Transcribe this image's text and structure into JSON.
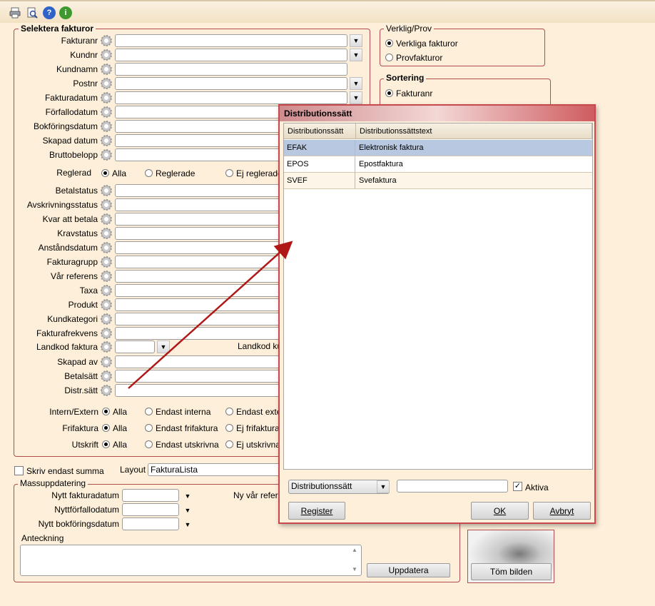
{
  "toolbar": {
    "icons": [
      "print-icon",
      "print-preview-icon",
      "help-icon",
      "info-icon"
    ],
    "help_glyph": "?",
    "info_glyph": "i"
  },
  "select_group": {
    "legend": "Selektera fakturor",
    "fields": [
      {
        "label": "Fakturanr",
        "dropdown": true
      },
      {
        "label": "Kundnr",
        "dropdown": true
      },
      {
        "label": "Kundnamn",
        "dropdown": false
      },
      {
        "label": "Postnr",
        "dropdown": true
      },
      {
        "label": "Fakturadatum",
        "dropdown": true
      },
      {
        "label": "Förfallodatum",
        "dropdown": false
      },
      {
        "label": "Bokföringsdatum",
        "dropdown": false
      },
      {
        "label": "Skapad datum",
        "dropdown": false
      },
      {
        "label": "Bruttobelopp",
        "dropdown": false
      }
    ],
    "reglerad": {
      "label": "Reglerad",
      "options": [
        "Alla",
        "Reglerade",
        "Ej reglerade"
      ],
      "selected": "Alla"
    },
    "fields2": [
      "Betalstatus",
      "Avskrivningsstatus",
      "Kvar att betala",
      "Kravstatus",
      "Anståndsdatum",
      "Fakturagrupp",
      "Vår referens",
      "Taxa",
      "Produkt",
      "Kundkategori",
      "Fakturafrekvens"
    ],
    "landkod_faktura": "Landkod faktura",
    "landkod_kund": "Landkod ku",
    "fields3": [
      "Skapad av",
      "Betalsätt",
      "Distr.sätt"
    ],
    "intern_extern": {
      "label": "Intern/Extern",
      "options": [
        "Alla",
        "Endast interna",
        "Endast exte"
      ],
      "selected": "Alla"
    },
    "frifaktura": {
      "label": "Frifaktura",
      "options": [
        "Alla",
        "Endast frifaktura",
        "Ej frifaktura"
      ],
      "selected": "Alla"
    },
    "utskrift": {
      "label": "Utskrift",
      "options": [
        "Alla",
        "Endast utskrivna",
        "Ej utskrivna"
      ],
      "selected": "Alla"
    }
  },
  "verklig_prov": {
    "legend": "Verklig/Prov",
    "options": [
      "Verkliga fakturor",
      "Provfakturor"
    ],
    "selected": "Verkliga fakturor"
  },
  "sortering": {
    "legend": "Sortering",
    "options": [
      "Fakturanr"
    ],
    "selected": "Fakturanr"
  },
  "skriv_summa": {
    "label": "Skriv endast summa",
    "checked": false
  },
  "layout": {
    "label": "Layout",
    "value": "FakturaLista"
  },
  "mass": {
    "legend": "Massuppdatering",
    "fields": [
      "Nytt fakturadatum",
      "Nyttförfallodatum",
      "Nytt bokföringsdatum"
    ],
    "ny_var_referens": "Ny vår referr",
    "anteckning": "Anteckning",
    "update_button": "Uppdatera"
  },
  "image_box": {
    "clear_button": "Töm bilden"
  },
  "dialog": {
    "title": "Distributionssätt",
    "columns": [
      "Distributionssätt",
      "Distributionssättstext"
    ],
    "rows": [
      {
        "code": "EFAK",
        "text": "Elektronisk faktura",
        "selected": true
      },
      {
        "code": "EPOS",
        "text": "Epostfaktura",
        "selected": false
      },
      {
        "code": "SVEF",
        "text": "Svefaktura",
        "selected": false
      }
    ],
    "filter_select": "Distributionssätt",
    "filter_value": "",
    "aktiva": {
      "label": "Aktiva",
      "checked": true
    },
    "register_button": "Register",
    "ok_button": "OK",
    "cancel_button": "Avbryt"
  },
  "colors": {
    "background": "#fdefd9",
    "group_border": "#b24b4b",
    "selected_row": "#b7c8e0",
    "arrow": "#b01818"
  }
}
